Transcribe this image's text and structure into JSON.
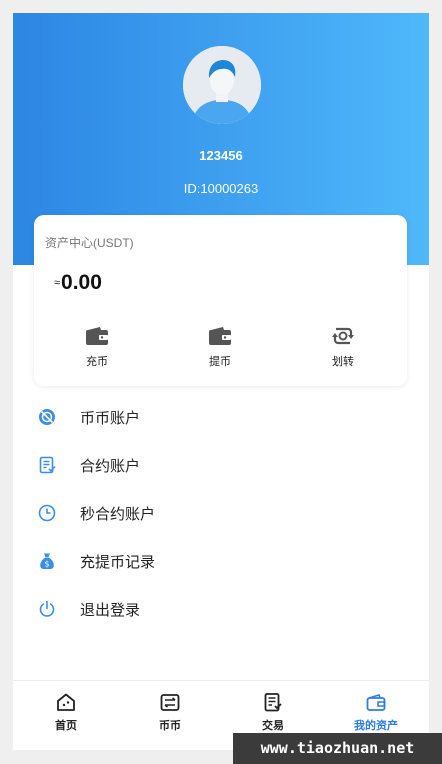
{
  "profile": {
    "username": "123456",
    "user_id": "ID:10000263"
  },
  "assets": {
    "title": "资产中心(USDT)",
    "approx_symbol": "≈",
    "amount": "0.00",
    "actions": [
      {
        "label": "充币",
        "icon": "wallet-icon"
      },
      {
        "label": "提币",
        "icon": "wallet-icon"
      },
      {
        "label": "划转",
        "icon": "transfer-icon"
      }
    ]
  },
  "menu": [
    {
      "label": "币币账户",
      "icon": "coin-account-icon"
    },
    {
      "label": "合约账户",
      "icon": "contract-icon"
    },
    {
      "label": "秒合约账户",
      "icon": "clock-icon"
    },
    {
      "label": "充提币记录",
      "icon": "money-bag-icon"
    },
    {
      "label": "退出登录",
      "icon": "power-icon"
    }
  ],
  "tabbar": {
    "tabs": [
      {
        "label": "首页",
        "icon": "home-icon"
      },
      {
        "label": "币币",
        "icon": "exchange-icon"
      },
      {
        "label": "交易",
        "icon": "trade-icon"
      },
      {
        "label": "我的资产",
        "icon": "wallet-icon"
      }
    ],
    "active_index": 3
  },
  "watermark": "www.tiaozhuan.net",
  "colors": {
    "header_gradient_start": "#2c86e3",
    "header_gradient_end": "#4fb8fb",
    "accent": "#2f7ce0",
    "icon_blue": "#3a8ee6",
    "action_icon": "#555555"
  }
}
